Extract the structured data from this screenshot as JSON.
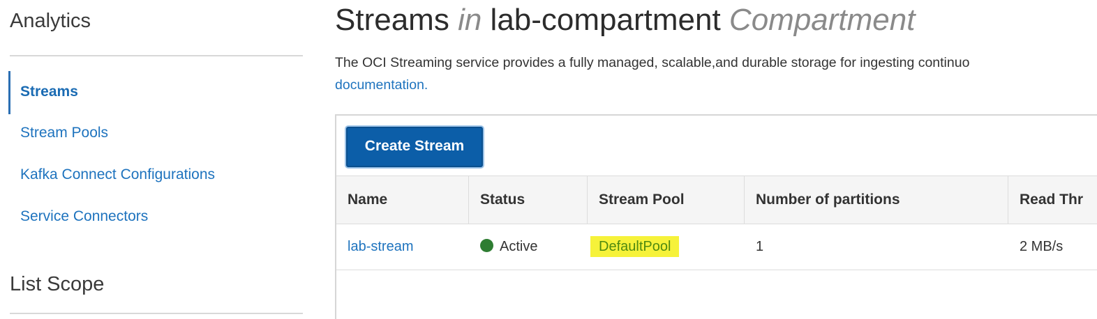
{
  "sidebar": {
    "heading": "Analytics",
    "nav_items": [
      {
        "label": "Streams",
        "active": true
      },
      {
        "label": "Stream Pools",
        "active": false
      },
      {
        "label": "Kafka Connect Configurations",
        "active": false
      },
      {
        "label": "Service Connectors",
        "active": false
      }
    ],
    "scope_heading": "List Scope"
  },
  "main": {
    "title": {
      "part1": "Streams",
      "part2": "in",
      "part3": "lab-compartment",
      "part4": "Compartment"
    },
    "description": "The OCI Streaming service provides a fully managed, scalable,and durable storage for ingesting continuo",
    "doc_link": "documentation.",
    "create_button": "Create Stream",
    "table": {
      "columns": [
        "Name",
        "Status",
        "Stream Pool",
        "Number of partitions",
        "Read Thr"
      ],
      "rows": [
        {
          "name": "lab-stream",
          "status": "Active",
          "stream_pool": "DefaultPool",
          "partitions": "1",
          "read_throughput": "2 MB/s"
        }
      ]
    }
  },
  "colors": {
    "link": "#1e73be",
    "primary_button": "#0c5ea8",
    "status_active": "#2e7d32",
    "highlight": "#f6f23a"
  },
  "icons": {
    "status": "status-dot-icon"
  }
}
